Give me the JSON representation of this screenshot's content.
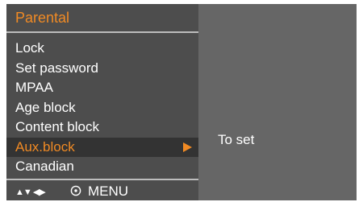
{
  "panel": {
    "title": "Parental"
  },
  "menu": {
    "items": [
      {
        "label": "Lock"
      },
      {
        "label": "Set password"
      },
      {
        "label": "MPAA"
      },
      {
        "label": "Age block"
      },
      {
        "label": "Content block"
      },
      {
        "label": "Aux.block",
        "selected": true
      },
      {
        "label": "Canadian"
      }
    ]
  },
  "help": {
    "text": "To set"
  },
  "footer": {
    "nav_glyphs": "▲▼ ◀▶",
    "ok_icon": "ok-circle-icon",
    "menu_label": "MENU"
  },
  "colors": {
    "accent": "#f08a24",
    "panel_bg": "#4d4d4d",
    "screen_bg": "#666666",
    "selected_bg": "#333333",
    "divider": "#bdbdbd",
    "text": "#ffffff"
  }
}
